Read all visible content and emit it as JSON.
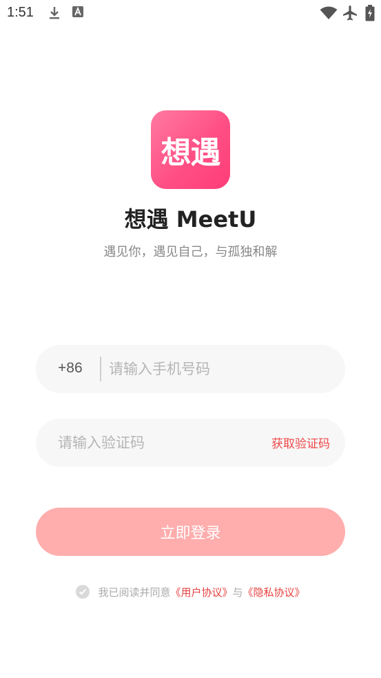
{
  "status_bar": {
    "time": "1:51",
    "icons": [
      "download-icon",
      "app-a-icon",
      "wifi-icon",
      "airplane-icon",
      "battery-icon"
    ]
  },
  "app": {
    "logo_text": "想遇",
    "title": "想遇 MeetU",
    "subtitle": "遇见你，遇见自己，与孤独和解"
  },
  "phone": {
    "country_code": "+86",
    "placeholder": "请输入手机号码",
    "value": ""
  },
  "code": {
    "placeholder": "请输入验证码",
    "value": "",
    "get_code_label": "获取验证码"
  },
  "login": {
    "label": "立即登录"
  },
  "agreement": {
    "prefix": "我已阅读并同意",
    "user_agreement": "《用户协议》",
    "conjunction": "与",
    "privacy_policy": "《隐私协议》",
    "checked": false
  },
  "colors": {
    "brand": "#ff4f85",
    "login_button": "#ffadad",
    "link": "#e84040"
  }
}
